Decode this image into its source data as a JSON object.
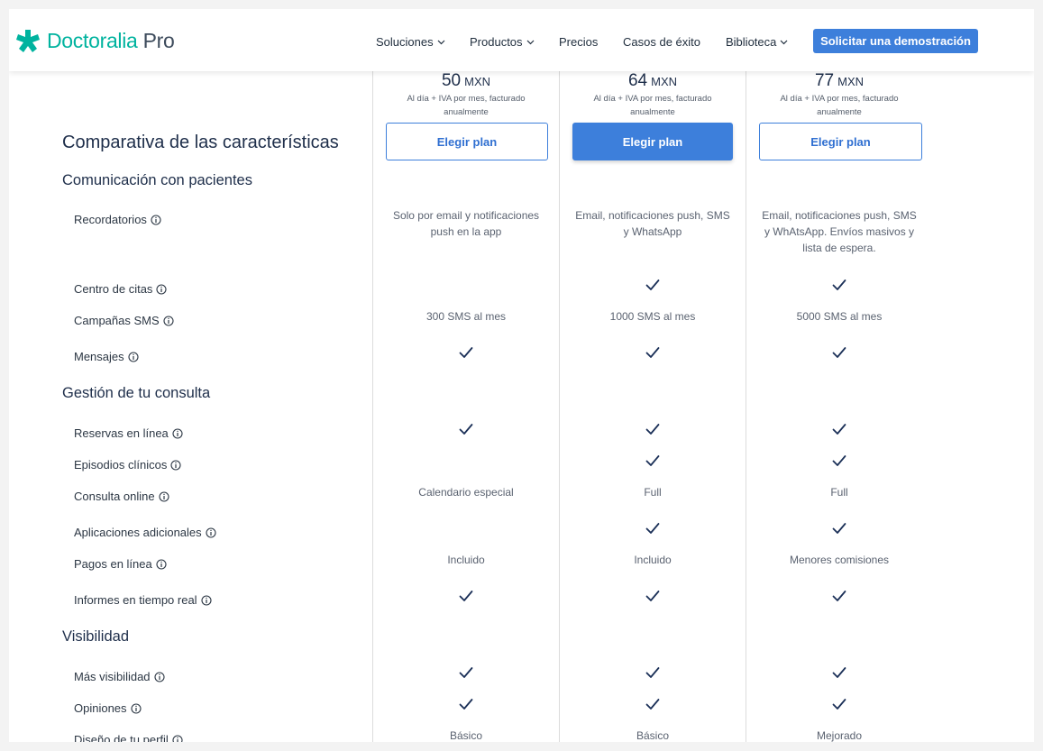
{
  "header": {
    "logo": {
      "brand": "Doctoralia",
      "suffix": "Pro"
    },
    "nav": [
      "Soluciones",
      "Productos",
      "Precios",
      "Casos de éxito",
      "Biblioteca"
    ],
    "cta": "Solicitar una demostración"
  },
  "plans": [
    {
      "price": "50",
      "currency": "MXN",
      "note": "Al día + IVA por mes, facturado anualmente",
      "button": "Elegir plan",
      "highlight": false
    },
    {
      "price": "64",
      "currency": "MXN",
      "note": "Al día + IVA por mes, facturado anualmente",
      "button": "Elegir plan",
      "highlight": true
    },
    {
      "price": "77",
      "currency": "MXN",
      "note": "Al día + IVA por mes, facturado anualmente",
      "button": "Elegir plan",
      "highlight": false
    }
  ],
  "title": "Comparativa de las características",
  "sections": [
    {
      "name": "Comunicación con pacientes",
      "features": [
        {
          "name": "Recordatorios",
          "values": [
            "Solo por email y notificaciones push en la app",
            "Email, notificaciones push, SMS y WhatsApp",
            "Email, notificaciones push, SMS y WhAtsApp. Envíos masivos y lista de espera."
          ]
        },
        {
          "name": "Centro de citas",
          "values": [
            "",
            "check",
            "check"
          ]
        },
        {
          "name": "Campañas SMS",
          "values": [
            "300 SMS al mes",
            "1000 SMS al mes",
            "5000 SMS al mes"
          ]
        },
        {
          "name": "Mensajes",
          "values": [
            "check",
            "check",
            "check"
          ]
        }
      ]
    },
    {
      "name": "Gestión de tu consulta",
      "features": [
        {
          "name": "Reservas en línea",
          "values": [
            "check",
            "check",
            "check"
          ]
        },
        {
          "name": "Episodios clínicos",
          "values": [
            "",
            "check",
            "check"
          ]
        },
        {
          "name": "Consulta online",
          "values": [
            "Calendario especial",
            "Full",
            "Full"
          ]
        },
        {
          "name": "Aplicaciones adicionales",
          "values": [
            "",
            "check",
            "check"
          ]
        },
        {
          "name": "Pagos en línea",
          "values": [
            "Incluido",
            "Incluido",
            "Menores comisiones"
          ]
        },
        {
          "name": "Informes en tiempo real",
          "values": [
            "check",
            "check",
            "check"
          ]
        }
      ]
    },
    {
      "name": "Visibilidad",
      "features": [
        {
          "name": "Más visibilidad",
          "values": [
            "check",
            "check",
            "check"
          ]
        },
        {
          "name": "Opiniones",
          "values": [
            "check",
            "check",
            "check"
          ]
        },
        {
          "name": "Diseño de tu perfil",
          "values": [
            "Básico",
            "Básico",
            "Mejorado"
          ]
        }
      ]
    }
  ],
  "colors": {
    "accent": "#3d7fdb",
    "brand": "#00b39f",
    "text": "#1e2e4a",
    "check": "#1a2f57"
  },
  "icons": {
    "check": "check-icon",
    "info": "info-icon",
    "chevron": "chevron-down-icon",
    "logo": "cross-star-logo"
  }
}
